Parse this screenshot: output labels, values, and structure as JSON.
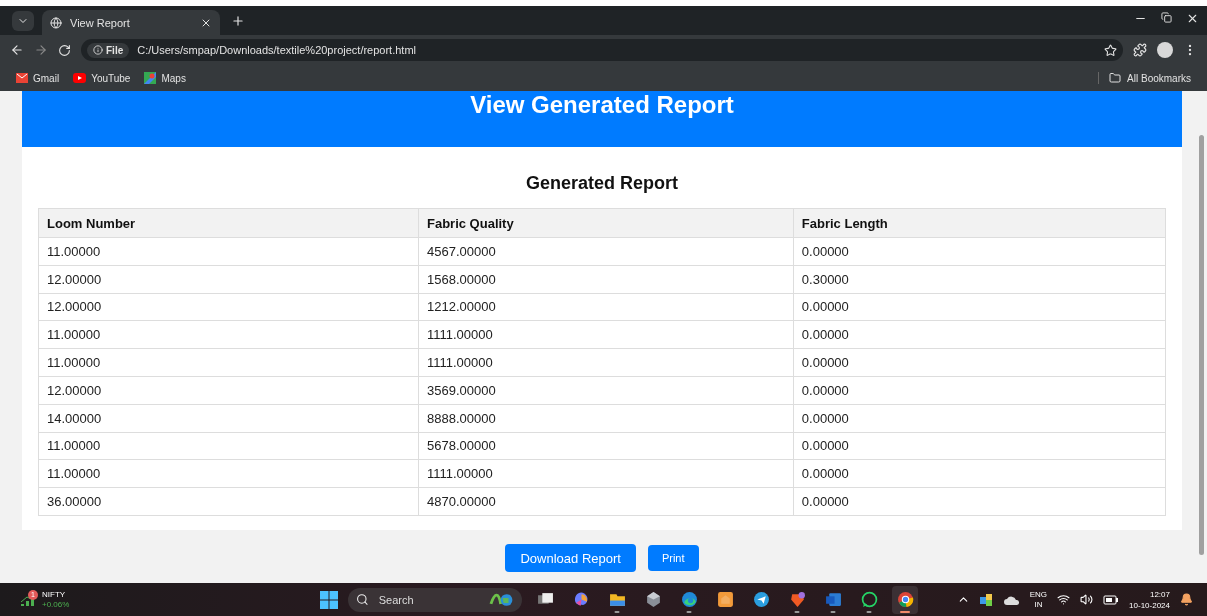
{
  "browser": {
    "tabs": [
      {
        "title": "View Report",
        "selected": true
      }
    ],
    "url_badge": "File",
    "url": "C:/Users/smpap/Downloads/textile%20project/report.html",
    "bookmarks": [
      {
        "label": "Gmail",
        "kind": "gmail"
      },
      {
        "label": "YouTube",
        "kind": "youtube"
      },
      {
        "label": "Maps",
        "kind": "maps"
      }
    ],
    "all_bookmarks": "All Bookmarks"
  },
  "page": {
    "header": "View Generated Report",
    "report_title": "Generated Report",
    "table": {
      "columns": [
        "Loom Number",
        "Fabric Quality",
        "Fabric Length"
      ],
      "rows": [
        [
          "11.00000",
          "4567.00000",
          "0.00000"
        ],
        [
          "12.00000",
          "1568.00000",
          "0.30000"
        ],
        [
          "12.00000",
          "1212.00000",
          "0.00000"
        ],
        [
          "11.00000",
          "1111.00000",
          "0.00000"
        ],
        [
          "11.00000",
          "1111.00000",
          "0.00000"
        ],
        [
          "12.00000",
          "3569.00000",
          "0.00000"
        ],
        [
          "14.00000",
          "8888.00000",
          "0.00000"
        ],
        [
          "11.00000",
          "5678.00000",
          "0.00000"
        ],
        [
          "11.00000",
          "1111.00000",
          "0.00000"
        ],
        [
          "36.00000",
          "4870.00000",
          "0.00000"
        ]
      ]
    },
    "buttons": [
      {
        "label": "Download Report",
        "kind": "large"
      },
      {
        "label": "Print",
        "kind": "small"
      }
    ]
  },
  "taskbar": {
    "widget": {
      "name": "NIFTY",
      "change": "+0.06%",
      "badge": "1"
    },
    "search": {
      "placeholder": "Search"
    },
    "apps": [
      {
        "kind": "taskview",
        "running": false,
        "active": false
      },
      {
        "kind": "copilot",
        "running": false,
        "active": false
      },
      {
        "kind": "files",
        "running": true,
        "active": false
      },
      {
        "kind": "cube",
        "running": false,
        "active": false
      },
      {
        "kind": "edge",
        "running": true,
        "active": false
      },
      {
        "kind": "home",
        "running": false,
        "active": false
      },
      {
        "kind": "telegram",
        "running": false,
        "active": false
      },
      {
        "kind": "brave",
        "running": true,
        "active": false
      },
      {
        "kind": "word",
        "running": true,
        "active": false
      },
      {
        "kind": "whatsapp",
        "running": true,
        "active": false
      },
      {
        "kind": "chrome",
        "running": true,
        "active": true
      }
    ],
    "language": [
      "ENG",
      "IN"
    ],
    "time": "12:07",
    "date": "10-10-2024"
  }
}
